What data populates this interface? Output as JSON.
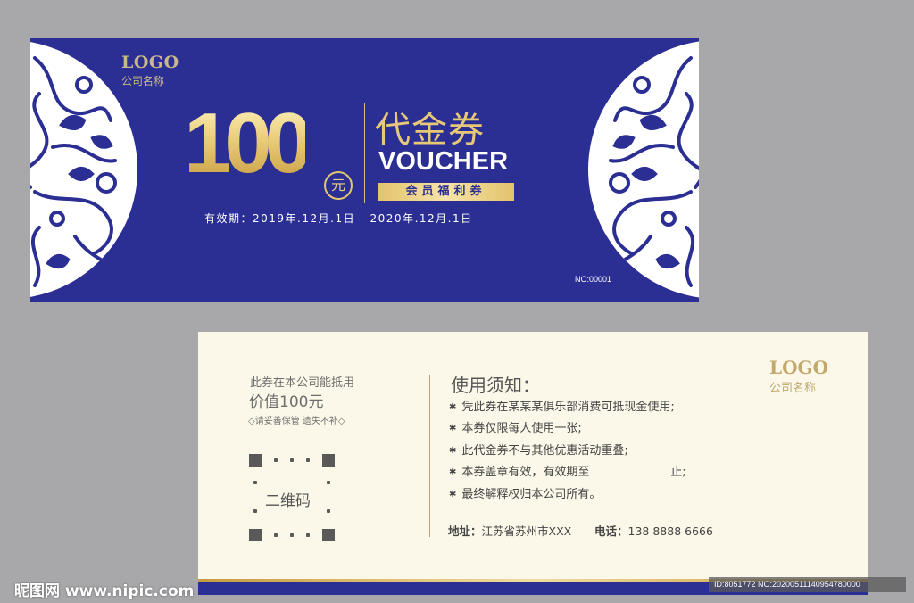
{
  "colors": {
    "front_background": "#2b2f93",
    "gold": "#e6c878",
    "back_background": "#fbf8e9"
  },
  "front": {
    "logo": "LOGO",
    "company_name": "公司名称",
    "amount": "100",
    "amount_unit": "元",
    "title_cn": "代金券",
    "title_en": "VOUCHER",
    "badge": "会员福利券",
    "validity": "有效期：2019年.12月.1日 - 2020年.12月.1日",
    "serial": "NO:00001",
    "decoration": "blue-white-floral-pattern"
  },
  "back": {
    "stub_line1": "此券在本公司能抵用",
    "stub_line2": "价值100元",
    "stub_note": "◇请妥善保管 遗失不补◇",
    "qr_label": "二维码",
    "rules_title": "使用须知：",
    "rules": [
      "凭此券在某某某俱乐部消费可抵现金使用;",
      "本券仅限每人使用一张;",
      "此代金券不与其他优惠活动重叠;",
      "本券盖章有效，有效期至                      止;",
      "最终解释权归本公司所有。"
    ],
    "address_label": "地址：",
    "address": "江苏省苏州市XXX",
    "phone_label": "电话：",
    "phone": "138 8888 6666",
    "logo": "LOGO",
    "company_name": "公司名称"
  },
  "watermark": {
    "site": "昵图网 www.nipic.com",
    "id": "ID:8051772 NO:20200511140954780000"
  }
}
